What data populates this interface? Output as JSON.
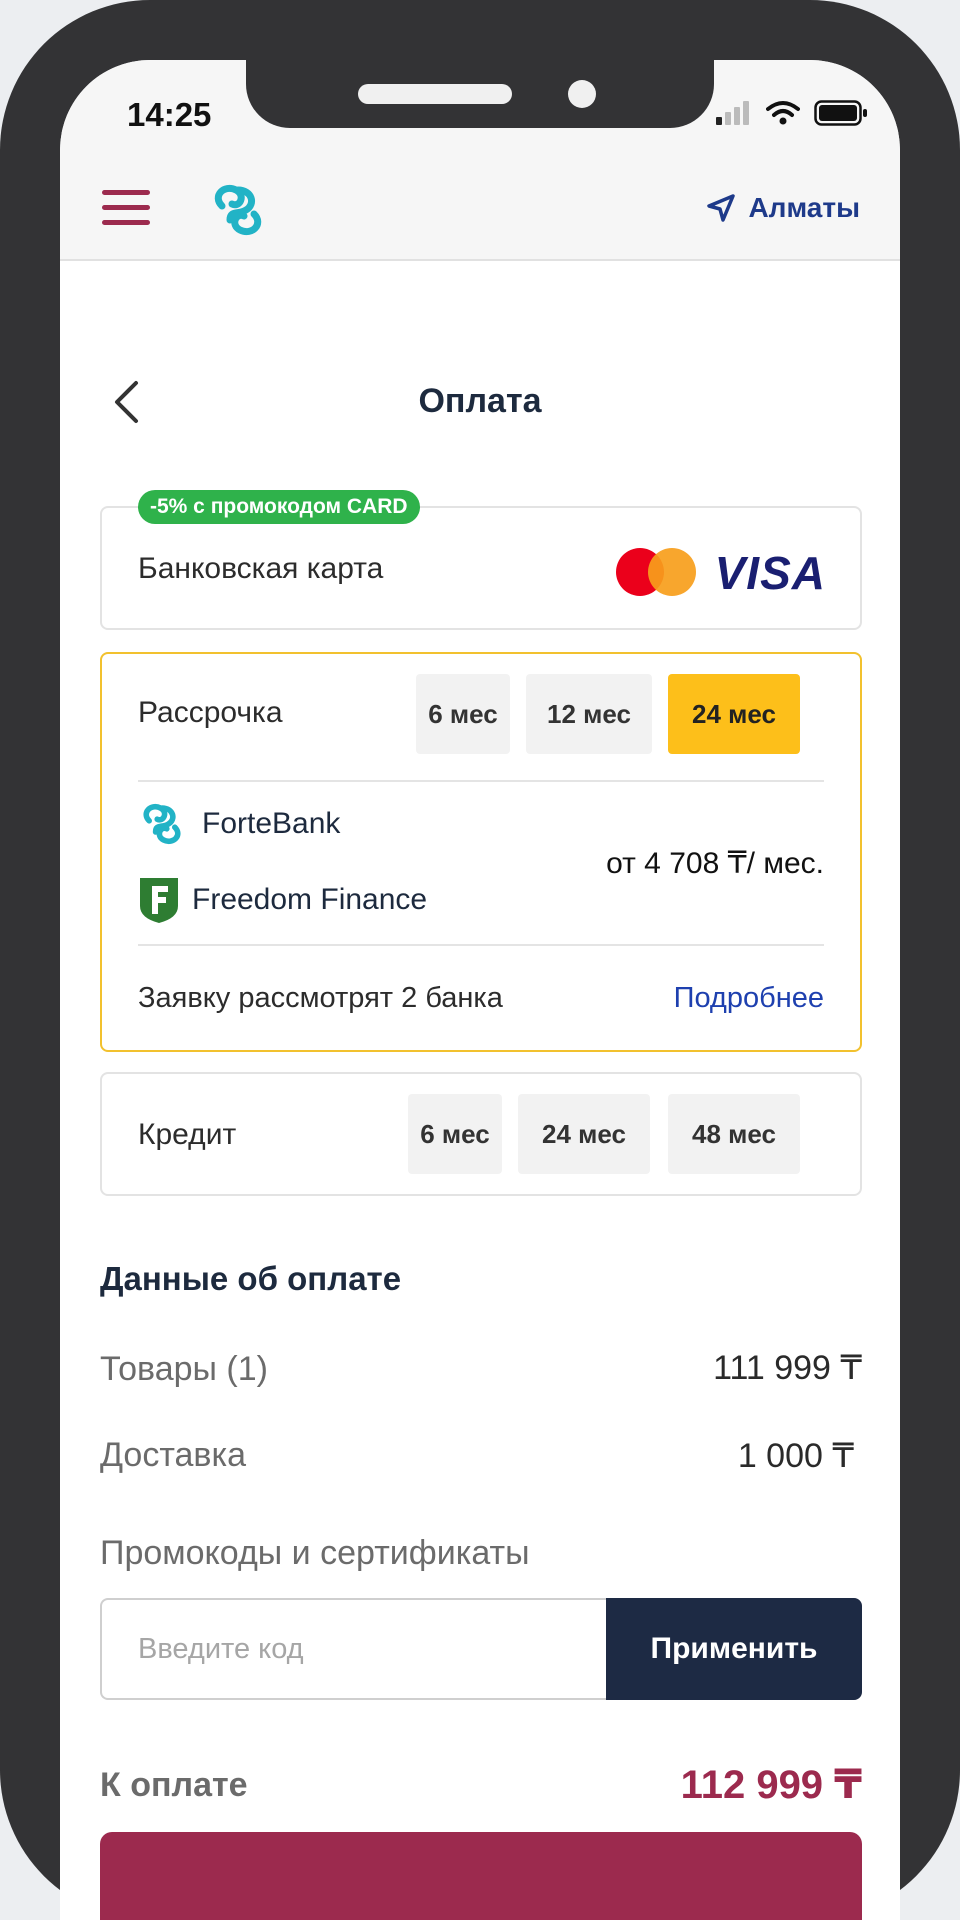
{
  "status_bar": {
    "time": "14:25"
  },
  "app_bar": {
    "city": "Алматы"
  },
  "page": {
    "title": "Оплата"
  },
  "payment_methods": {
    "bank_card": {
      "badge": "-5% с промокодом CARD",
      "label": "Банковская карта",
      "visa_text": "VISA"
    },
    "installment": {
      "label": "Рассрочка",
      "terms": [
        {
          "label": "6 мес",
          "active": false
        },
        {
          "label": "12 мес",
          "active": false
        },
        {
          "label": "24 мес",
          "active": true
        }
      ],
      "banks": [
        {
          "name": "ForteBank"
        },
        {
          "name": "Freedom Finance"
        }
      ],
      "monthly_payment": "от 4 708 ₸/ мес.",
      "note": "Заявку рассмотрят 2 банка",
      "more_link": "Подробнее"
    },
    "credit": {
      "label": "Кредит",
      "terms": [
        {
          "label": "6 мес"
        },
        {
          "label": "24 мес"
        },
        {
          "label": "48 мес"
        }
      ]
    }
  },
  "payment_details": {
    "title": "Данные об оплате",
    "goods_label": "Товары (1)",
    "goods_value": "111 999 ₸",
    "delivery_label": "Доставка",
    "delivery_value": "1 000 ₸",
    "promo_label": "Промокоды и сертификаты",
    "promo_placeholder": "Введите код",
    "apply_label": "Применить",
    "total_label": "К оплате",
    "total_value": "112 999 ₸"
  },
  "colors": {
    "brand": "#9c2a4e",
    "accent_yellow": "#fdbf1a",
    "promo_green": "#2fb24b",
    "dark_navy": "#1d2a44",
    "link_blue": "#1e40af"
  }
}
